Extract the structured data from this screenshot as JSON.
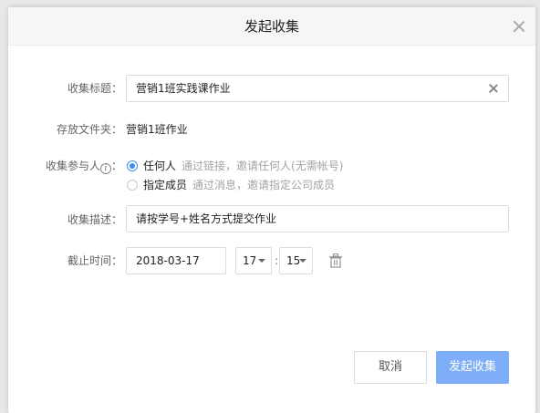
{
  "dialog": {
    "title": "发起收集",
    "close_icon": "close-icon"
  },
  "form": {
    "title_label": "收集标题：",
    "title_value": "营销1班实践课作业",
    "folder_label": "存放文件夹：",
    "folder_value": "营销1班作业",
    "participants_label": "收集参与人",
    "participants_colon": "：",
    "participants_options": [
      {
        "label": "任何人",
        "hint": "通过链接，邀请任何人(无需帐号)",
        "checked": true
      },
      {
        "label": "指定成员",
        "hint": "通过消息，邀请指定公司成员",
        "checked": false
      }
    ],
    "description_label": "收集描述：",
    "description_value": "请按学号+姓名方式提交作业",
    "deadline_label": "截止时间：",
    "deadline_date": "2018-03-17",
    "deadline_hour": "17",
    "deadline_minute": "15",
    "time_separator": ":"
  },
  "buttons": {
    "cancel": "取消",
    "submit": "发起收集"
  },
  "colors": {
    "primary": "#7eaef8",
    "radio_accent": "#3b8ef0"
  }
}
